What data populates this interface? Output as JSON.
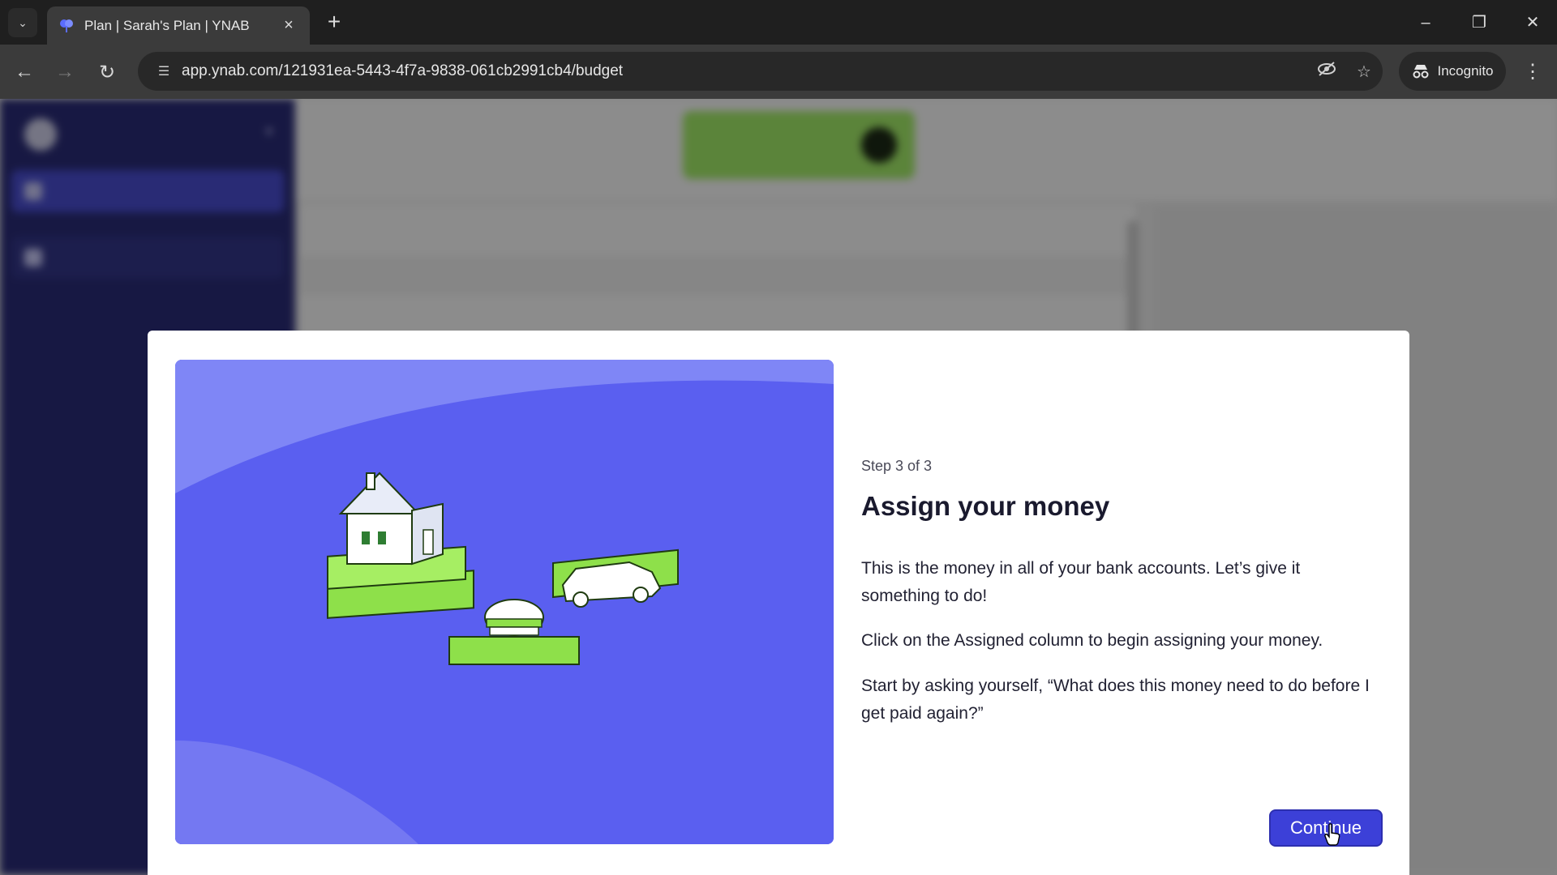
{
  "browser": {
    "tab_title": "Plan | Sarah's Plan | YNAB",
    "url": "app.ynab.com/121931ea-5443-4f7a-9838-061cb2991cb4/budget",
    "incognito_label": "Incognito"
  },
  "modal": {
    "step": "Step 3 of 3",
    "title": "Assign your money",
    "paragraph1": "This is the money in all of your bank accounts. Let’s give it something to do!",
    "paragraph2": "Click on the Assigned column to begin assigning your money.",
    "paragraph3": "Start by asking yourself, “What does this money need to do before I get paid again?”",
    "continue_label": "Continue"
  },
  "colors": {
    "modal_illustration_bg": "#5a5ff0",
    "primary_button": "#3c40d8",
    "sidebar_bg": "#2b2d7a",
    "ready_to_assign_bg": "#a7f06b",
    "money_green": "#8ee04a"
  },
  "icons": {
    "tab_favicon": "ynab-tree-icon",
    "back": "arrow-left-icon",
    "forward": "arrow-right-icon",
    "reload": "reload-icon",
    "site_info": "tune-icon",
    "eye_off": "eye-off-icon",
    "bookmark": "star-icon",
    "incognito": "incognito-icon",
    "menu": "kebab-icon"
  }
}
